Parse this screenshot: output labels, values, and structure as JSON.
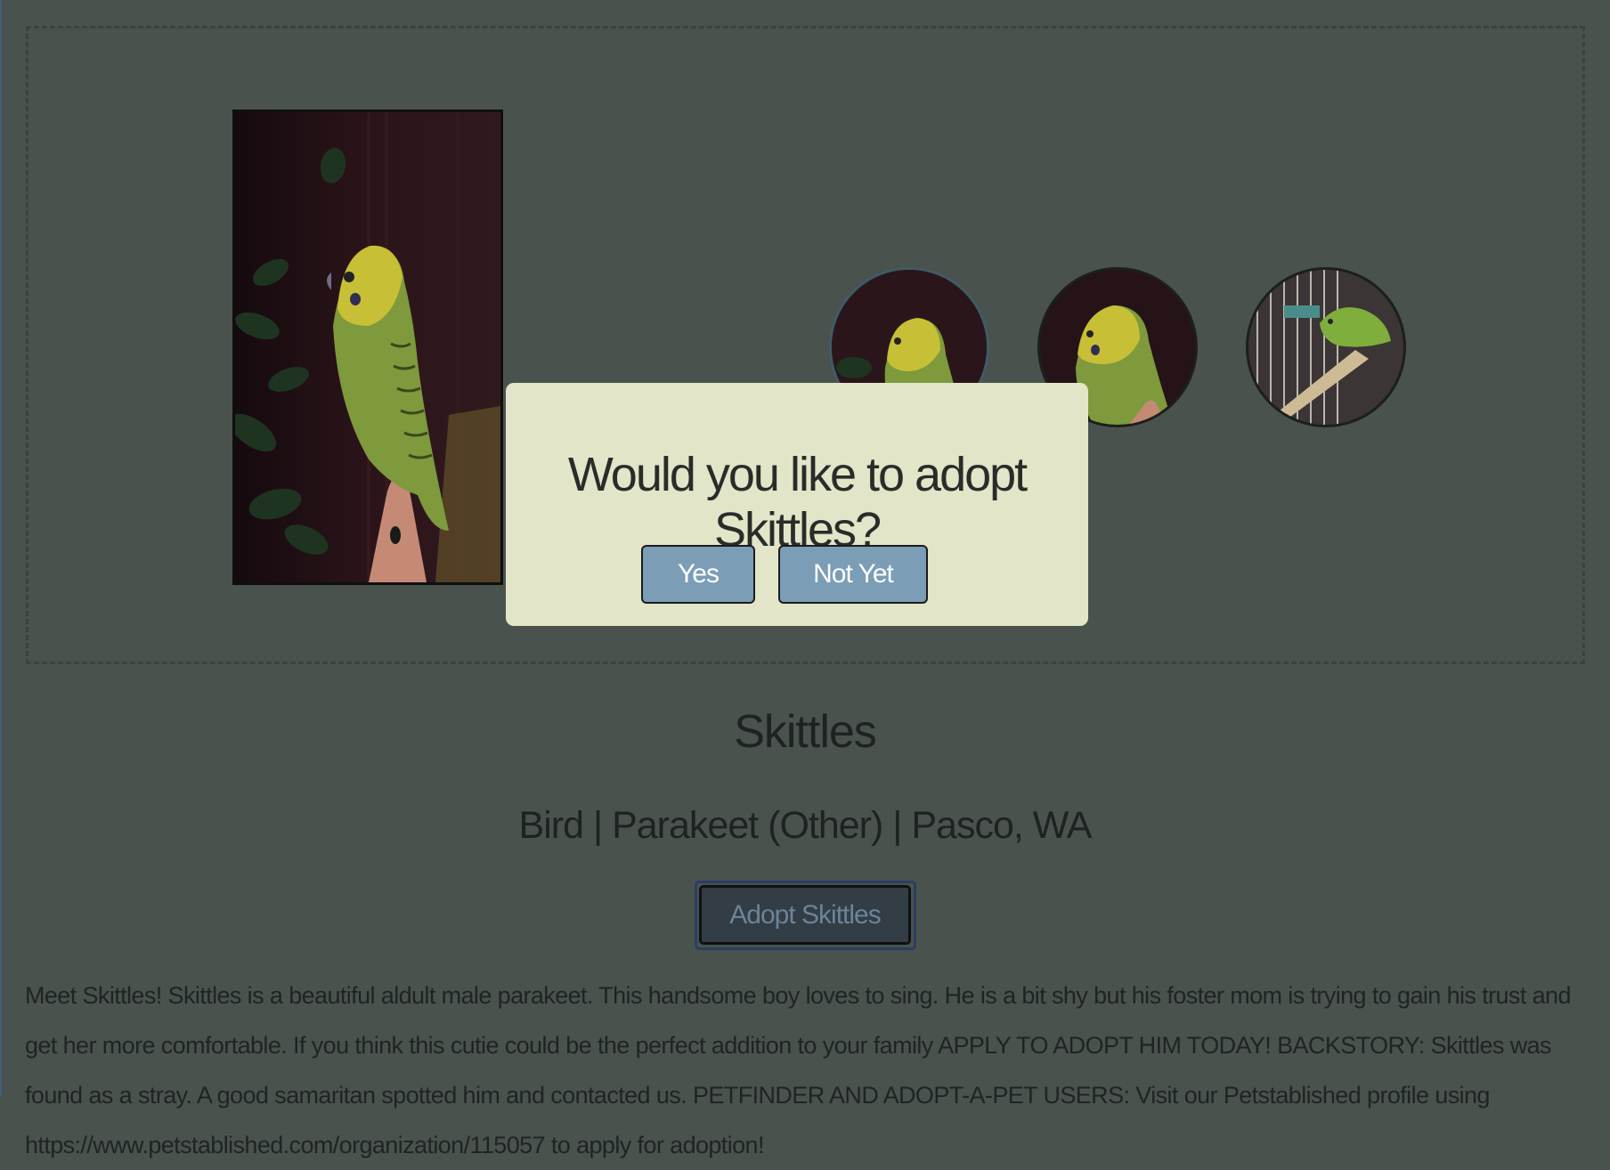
{
  "pet": {
    "name": "Skittles",
    "meta": "Bird | Parakeet (Other) | Pasco, WA",
    "adopt_label": "Adopt Skittles",
    "description": "Meet Skittles! Skittles is a beautiful aldult male parakeet. This handsome boy loves to sing. He is a bit shy but his foster mom is trying to gain his trust and get her more comfortable. If you think this cutie could be the perfect addition to your family APPLY TO ADOPT HIM TODAY! BACKSTORY: Skittles was found as a stray. A good samaritan spotted him and contacted us. PETFINDER AND ADOPT-A-PET USERS: Visit our Petstablished profile using https://www.petstablished.com/organization/115057 to apply for adoption!"
  },
  "dialog": {
    "question": "Would you like to adopt Skittles?",
    "yes_label": "Yes",
    "no_label": "Not Yet"
  },
  "colors": {
    "overlay_bg": "#4a524d",
    "dialog_bg": "#e3e5c8",
    "dialog_button": "#7b9db6",
    "adopt_button_bg": "#323d45",
    "adopt_button_text": "#6e8398"
  }
}
